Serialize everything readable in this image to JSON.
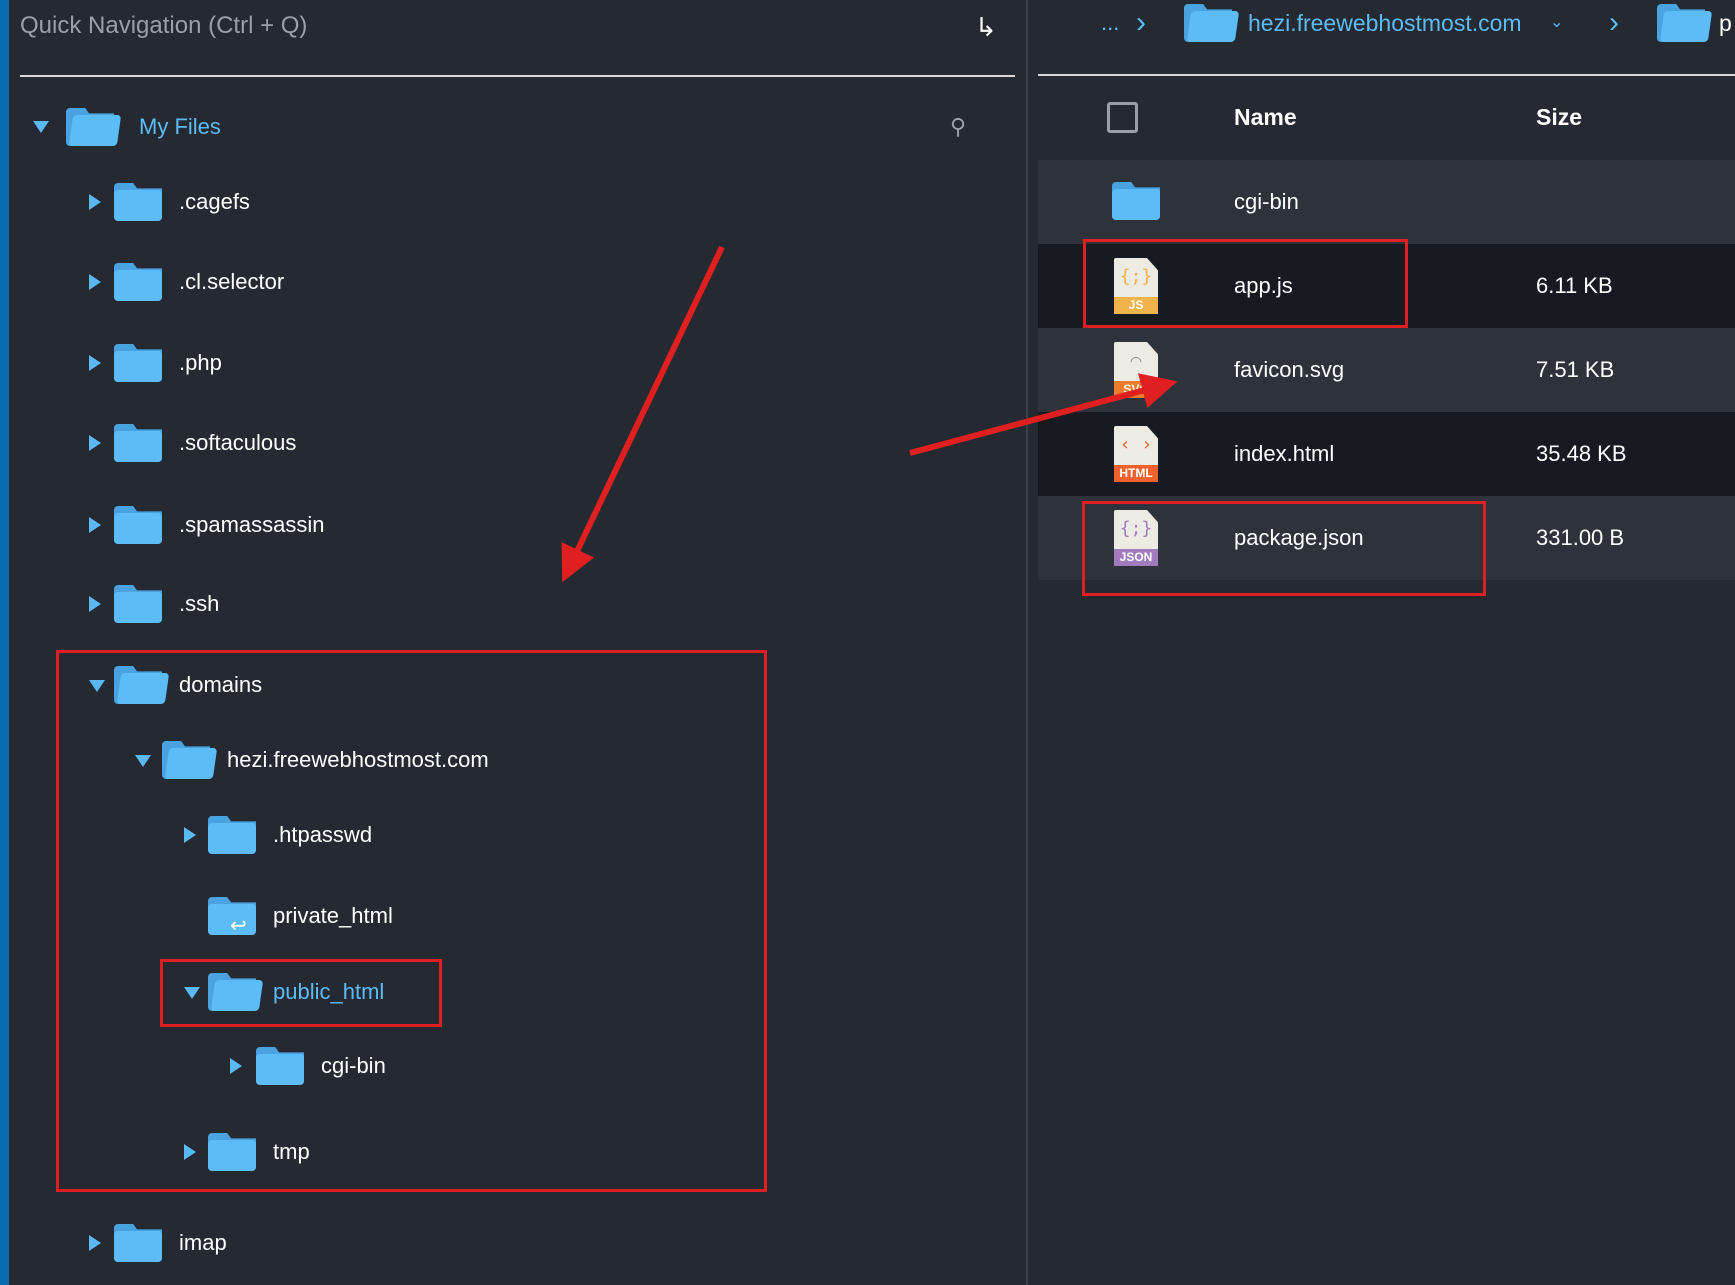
{
  "quick_nav": {
    "placeholder": "Quick Navigation (Ctrl + Q)",
    "go_icon": "enter-arrow-icon"
  },
  "tree": {
    "root": "My Files",
    "items": [
      {
        "label": ".cagefs",
        "level": 1,
        "state": "collapsed"
      },
      {
        "label": ".cl.selector",
        "level": 1,
        "state": "collapsed"
      },
      {
        "label": ".php",
        "level": 1,
        "state": "collapsed"
      },
      {
        "label": ".softaculous",
        "level": 1,
        "state": "collapsed"
      },
      {
        "label": ".spamassassin",
        "level": 1,
        "state": "collapsed"
      },
      {
        "label": ".ssh",
        "level": 1,
        "state": "collapsed"
      },
      {
        "label": "domains",
        "level": 1,
        "state": "expanded"
      },
      {
        "label": "hezi.freewebhostmost.com",
        "level": 2,
        "state": "expanded"
      },
      {
        "label": ".htpasswd",
        "level": 3,
        "state": "collapsed"
      },
      {
        "label": "private_html",
        "level": 3,
        "state": "link"
      },
      {
        "label": "public_html",
        "level": 3,
        "state": "expanded",
        "selected": true
      },
      {
        "label": "cgi-bin",
        "level": 4,
        "state": "collapsed"
      },
      {
        "label": "tmp",
        "level": 3,
        "state": "collapsed"
      },
      {
        "label": "imap",
        "level": 1,
        "state": "collapsed"
      }
    ]
  },
  "breadcrumb": {
    "ellipsis": "...",
    "items": [
      "hezi.freewebhostmost.com",
      "p"
    ]
  },
  "table": {
    "headers": {
      "name": "Name",
      "size": "Size"
    },
    "rows": [
      {
        "name": "cgi-bin",
        "size": "",
        "type": "folder"
      },
      {
        "name": "app.js",
        "size": "6.11 KB",
        "type": "JS"
      },
      {
        "name": "favicon.svg",
        "size": "7.51 KB",
        "type": "SVG"
      },
      {
        "name": "index.html",
        "size": "35.48 KB",
        "type": "HTML"
      },
      {
        "name": "package.json",
        "size": "331.00 B",
        "type": "JSON"
      }
    ]
  },
  "colors": {
    "accent": "#5cbcf8",
    "annotation": "#e02020",
    "js": "#f0b24a",
    "svg": "#ee7d2b",
    "html": "#f0622d",
    "json": "#a27bbd"
  }
}
